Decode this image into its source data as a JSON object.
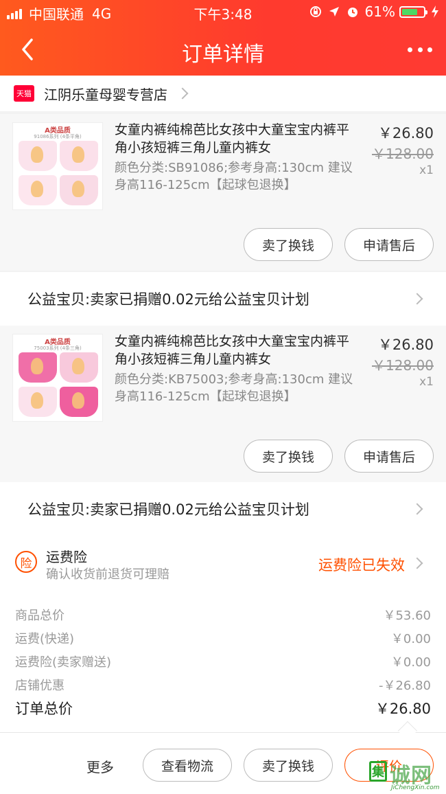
{
  "status_bar": {
    "carrier": "中国联通",
    "network": "4G",
    "time": "下午3:48",
    "battery": "61%"
  },
  "nav": {
    "title": "订单详情"
  },
  "store": {
    "badge": "天猫",
    "name": "江阴乐童母婴专营店"
  },
  "products": [
    {
      "thumb_grade": "A类品质",
      "thumb_series": "91086系列 (4条平角)",
      "title": "女童内裤纯棉芭比女孩中大童宝宝内裤平角小孩短裤三角儿童内裤女",
      "spec": "颜色分类:SB91086;参考身高:130cm 建议身高116-125cm【起球包退换】",
      "price": "￥26.80",
      "original_price": "￥128.00",
      "quantity": "x1",
      "btn_sell": "卖了换钱",
      "btn_after": "申请售后"
    },
    {
      "thumb_grade": "A类品质",
      "thumb_series": "75003系列 (4条三角)",
      "title": "女童内裤纯棉芭比女孩中大童宝宝内裤平角小孩短裤三角儿童内裤女",
      "spec": "颜色分类:KB75003;参考身高:130cm 建议身高116-125cm【起球包退换】",
      "price": "￥26.80",
      "original_price": "￥128.00",
      "quantity": "x1",
      "btn_sell": "卖了换钱",
      "btn_after": "申请售后"
    }
  ],
  "charity": [
    "公益宝贝:卖家已捐赠0.02元给公益宝贝计划",
    "公益宝贝:卖家已捐赠0.02元给公益宝贝计划"
  ],
  "insurance": {
    "badge": "险",
    "title": "运费险",
    "subtitle": "确认收货前退货可理赔",
    "status": "运费险已失效"
  },
  "summary": {
    "rows": [
      {
        "label": "商品总价",
        "value": "￥53.60"
      },
      {
        "label": "运费(快递)",
        "value": "￥0.00"
      },
      {
        "label": "运费险(卖家赠送)",
        "value": "￥0.00"
      },
      {
        "label": "店铺优惠",
        "value": "-￥26.80"
      }
    ],
    "total_label": "订单总价",
    "total_value": "￥26.80"
  },
  "bottom_bar": {
    "more": "更多",
    "logistics": "查看物流",
    "sell": "卖了换钱",
    "review": "评价"
  },
  "watermark": {
    "box_char": "集",
    "text": "诚网",
    "url": "JiChengXin.com"
  },
  "colors": {
    "header_start": "#ff5a1e",
    "header_end": "#ff3a32",
    "accent": "#ff5000",
    "tmall_red": "#ff0036"
  }
}
